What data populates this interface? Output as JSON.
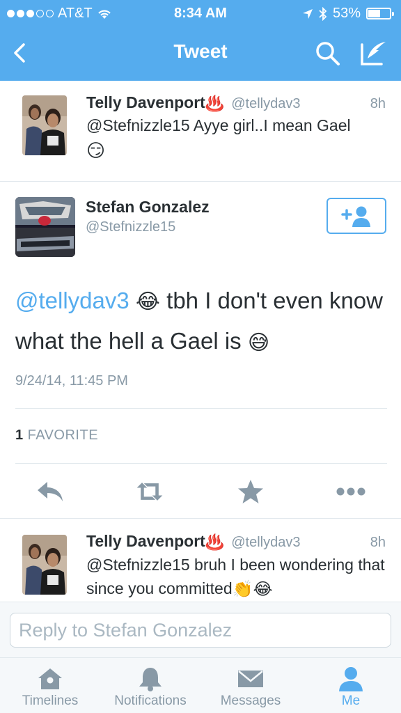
{
  "status_bar": {
    "carrier": "AT&T",
    "time": "8:34 AM",
    "battery": "53%",
    "battery_level": 0.53,
    "signal_bars": 3,
    "signal_total": 5
  },
  "nav": {
    "title": "Tweet",
    "back_icon": "chevron-left-icon",
    "search_icon": "search-icon",
    "compose_icon": "compose-tweet-icon"
  },
  "parent_tweet": {
    "name": "Telly Davenport",
    "name_emoji": "♨️",
    "handle": "@tellydav3",
    "time": "8h",
    "text": "@Stefnizzle15 Ayye girl..I mean Gael",
    "emoji": "😏"
  },
  "main_tweet": {
    "name": "Stefan Gonzalez",
    "handle": "@Stefnizzle15",
    "mention": "@tellydav3",
    "emoji_1": "😂",
    "text_1": " tbh I don't even know what the hell a Gael is ",
    "emoji_2": "😅",
    "date": "9/24/14, 11:45 PM",
    "favorite_count": "1",
    "favorite_label": "FAVORITE",
    "follow_icon": "add-user-icon"
  },
  "actions": {
    "reply_icon": "reply-icon",
    "retweet_icon": "retweet-icon",
    "favorite_icon": "star-icon",
    "more_icon": "more-dots-icon"
  },
  "reply_tweet": {
    "name": "Telly Davenport",
    "name_emoji": "♨️",
    "handle": "@tellydav3",
    "time": "8h",
    "text_1": "@Stefnizzle15 bruh I been wondering that since you committed",
    "emoji_1": "👏",
    "emoji_2": "😂"
  },
  "reply_bar": {
    "placeholder": "Reply to Stefan Gonzalez"
  },
  "tabs": [
    {
      "label": "Timelines",
      "icon": "home-icon"
    },
    {
      "label": "Notifications",
      "icon": "bell-icon"
    },
    {
      "label": "Messages",
      "icon": "envelope-icon"
    },
    {
      "label": "Me",
      "icon": "person-icon",
      "active": true
    }
  ],
  "colors": {
    "brand": "#55acee",
    "text": "#292f33",
    "muted": "#8899a6"
  }
}
